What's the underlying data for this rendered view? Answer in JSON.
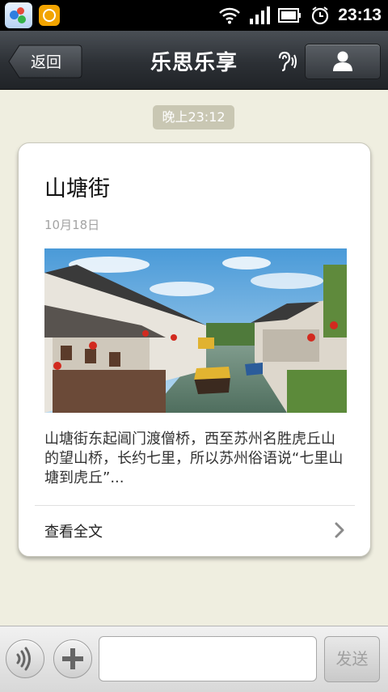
{
  "status_bar": {
    "time": "23:13",
    "icons": [
      "app-icon",
      "notification-icon",
      "wifi-icon",
      "signal-icon",
      "battery-icon",
      "alarm-icon"
    ]
  },
  "header": {
    "back_label": "返回",
    "title": "乐思乐享",
    "ear_icon": "ear-icon",
    "profile_icon": "person-icon"
  },
  "chat": {
    "timestamp": "晚上23:12"
  },
  "card": {
    "title": "山塘街",
    "date": "10月18日",
    "image": "canal-town-photo",
    "summary": "山塘街东起阊门渡僧桥，西至苏州名胜虎丘山的望山桥，长约七里，所以苏州俗语说“七里山塘到虎丘”...",
    "read_more_label": "查看全文"
  },
  "input_bar": {
    "voice_icon": "voice-icon",
    "plus_icon": "plus-icon",
    "message_value": "",
    "send_label": "发送"
  }
}
